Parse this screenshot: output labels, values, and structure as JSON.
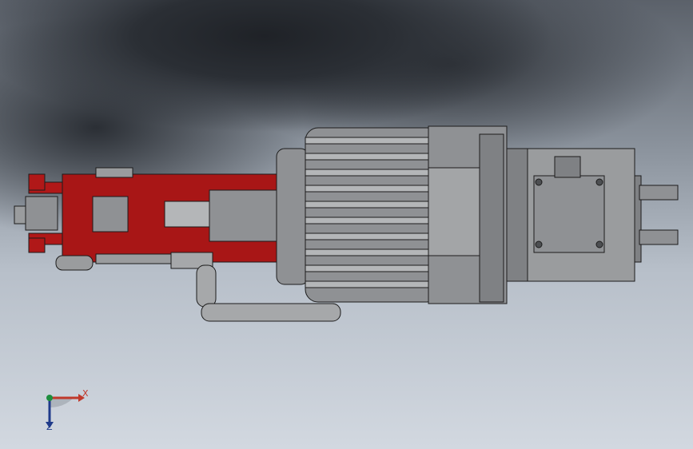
{
  "triad": {
    "x_label": "X",
    "z_label": "Z",
    "colors": {
      "x": "#c0392b",
      "y": "#1e8e3e",
      "z": "#1f3a8a"
    }
  },
  "model": {
    "colors": {
      "red_parts": "#b01818",
      "red_dark": "#6f0b0b",
      "gray_body": "#8f9194",
      "gray_light": "#b4b6b8",
      "gray_dark": "#4d4f52",
      "outline": "#1c1c1c"
    }
  }
}
